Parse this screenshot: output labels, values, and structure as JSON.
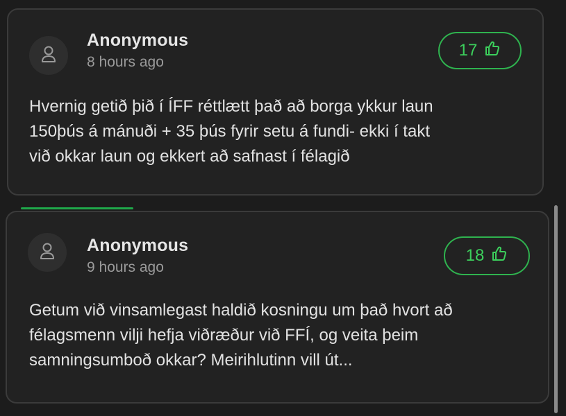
{
  "comments": [
    {
      "author": "Anonymous",
      "time": "8 hours ago",
      "likes": "17",
      "text_lines": [
        "Hvernig getið þið í ÍFF réttlætt það að borga ykkur laun",
        "150þús á mánuði + 35 þús fyrir setu á fundi- ekki í takt",
        "við okkar laun og ekkert að safnast í félagið"
      ]
    },
    {
      "author": "Anonymous",
      "time": "9 hours ago",
      "likes": "18",
      "text_lines": [
        "Getum við vinsamlegast haldið kosningu um það hvort að",
        "félagsmenn vilji hefja viðræður við FFÍ, og veita þeim",
        "samningsumboð okkar? Meirihlutinn vill út..."
      ]
    }
  ],
  "colors": {
    "background": "#1c1c1c",
    "card": "#222222",
    "accent": "#3ccf5c"
  },
  "icons": {
    "avatar": "user-icon",
    "like": "thumbs-up-icon"
  }
}
